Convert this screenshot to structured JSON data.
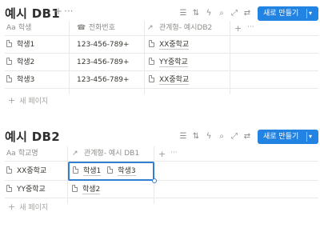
{
  "db1": {
    "title": "예시 DB1",
    "new_button": "새로 만들기",
    "columns": [
      {
        "icon": "Aa",
        "label": "학생"
      },
      {
        "icon": "☎",
        "label": "전화번호"
      },
      {
        "icon": "↗",
        "label": "관계형- 예시DB2"
      }
    ],
    "rows": [
      {
        "name": "학생1",
        "phone": "123-456-789+",
        "relation": "XX중학교"
      },
      {
        "name": "학생2",
        "phone": "123-456-789+",
        "relation": "YY중학교"
      },
      {
        "name": "학생3",
        "phone": "123-456-789+",
        "relation": "XX중학교"
      }
    ],
    "new_page": "새 페이지"
  },
  "db2": {
    "title": "예시 DB2",
    "new_button": "새로 만들기",
    "columns": [
      {
        "icon": "Aa",
        "label": "학교명"
      },
      {
        "icon": "↗",
        "label": "관계형- 예시 DB1"
      }
    ],
    "rows": [
      {
        "name": "XX중학교",
        "relations": [
          "학생1",
          "학생3"
        ]
      },
      {
        "name": "YY중학교",
        "relations": [
          "학생2"
        ]
      }
    ],
    "new_page": "새 페이지"
  },
  "common": {
    "plus": "+",
    "more": "···"
  }
}
